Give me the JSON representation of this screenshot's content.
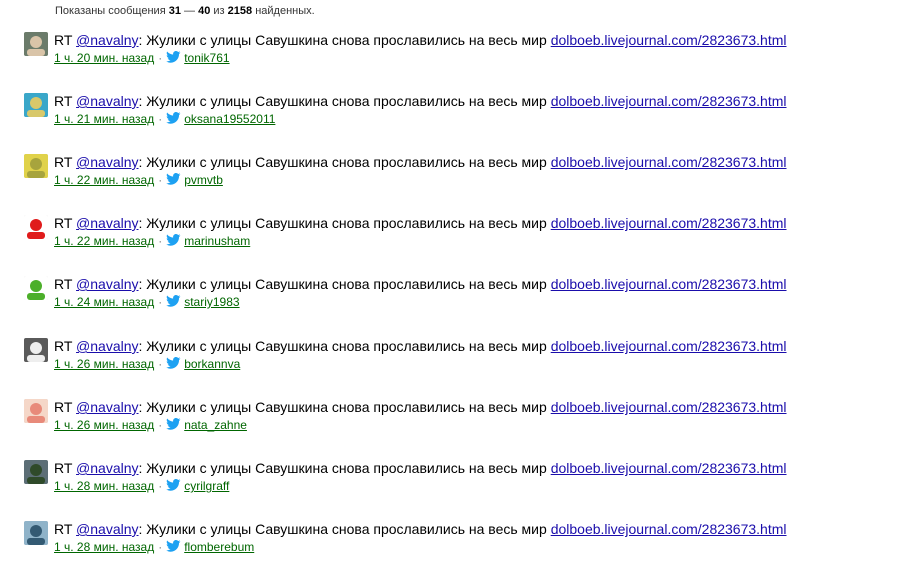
{
  "summary": {
    "prefix": "Показаны сообщения ",
    "from": "31",
    "dash": " — ",
    "to": "40",
    "of": " из ",
    "total": "2158",
    "suffix": " найденных."
  },
  "colors": {
    "link": "#1a0dab",
    "meta_link": "#006600",
    "twitter_blue": "#1da1f2"
  },
  "tweets": [
    {
      "rt": "RT",
      "mention": "@navalny",
      "text": ": Жулики с улицы Савушкина снова прославились на весь мир ",
      "url": "dolboeb.livejournal.com/2823673.html",
      "time": "1 ч. 20 мин. назад",
      "sep": "·",
      "user": "tonik761",
      "avatar_icon": "user-avatar-man-icon",
      "avatar_colors": [
        "#6b7b6a",
        "#d9c4a8"
      ]
    },
    {
      "rt": "RT",
      "mention": "@navalny",
      "text": ": Жулики с улицы Савушкина снова прославились на весь мир ",
      "url": "dolboeb.livejournal.com/2823673.html",
      "time": "1 ч. 21 мин. назад",
      "sep": "·",
      "user": "oksana19552011",
      "avatar_icon": "user-avatar-beach-icon",
      "avatar_colors": [
        "#3aa7c9",
        "#d8c86a"
      ]
    },
    {
      "rt": "RT",
      "mention": "@navalny",
      "text": ": Жулики с улицы Савушкина снова прославились на весь мир ",
      "url": "dolboeb.livejournal.com/2823673.html",
      "time": "1 ч. 22 мин. назад",
      "sep": "·",
      "user": "pvmvtb",
      "avatar_icon": "user-avatar-person-icon",
      "avatar_colors": [
        "#e0d24a",
        "#a7a43d"
      ]
    },
    {
      "rt": "RT",
      "mention": "@navalny",
      "text": ": Жулики с улицы Савушкина снова прославились на весь мир ",
      "url": "dolboeb.livejournal.com/2823673.html",
      "time": "1 ч. 22 мин. назад",
      "sep": "·",
      "user": "marinusham",
      "avatar_icon": "user-avatar-heart-icon",
      "avatar_colors": [
        "#ffffff",
        "#e01b1b"
      ]
    },
    {
      "rt": "RT",
      "mention": "@navalny",
      "text": ": Жулики с улицы Савушкина снова прославились на весь мир ",
      "url": "dolboeb.livejournal.com/2823673.html",
      "time": "1 ч. 24 мин. назад",
      "sep": "·",
      "user": "stariy1983",
      "avatar_icon": "user-avatar-frog-icon",
      "avatar_colors": [
        "#ffffff",
        "#4caf2a"
      ]
    },
    {
      "rt": "RT",
      "mention": "@navalny",
      "text": ": Жулики с улицы Савушкина снова прославились на весь мир ",
      "url": "dolboeb.livejournal.com/2823673.html",
      "time": "1 ч. 26 мин. назад",
      "sep": "·",
      "user": "borkannva",
      "avatar_icon": "user-avatar-dog-icon",
      "avatar_colors": [
        "#5a5a5a",
        "#eeeeee"
      ]
    },
    {
      "rt": "RT",
      "mention": "@navalny",
      "text": ": Жулики с улицы Савушкина снова прославились на весь мир ",
      "url": "dolboeb.livejournal.com/2823673.html",
      "time": "1 ч. 26 мин. назад",
      "sep": "·",
      "user": "nata_zahne",
      "avatar_icon": "user-avatar-girl-icon",
      "avatar_colors": [
        "#f5d7c8",
        "#e88a7a"
      ]
    },
    {
      "rt": "RT",
      "mention": "@navalny",
      "text": ": Жулики с улицы Савушкина снова прославились на весь мир ",
      "url": "dolboeb.livejournal.com/2823673.html",
      "time": "1 ч. 28 мин. назад",
      "sep": "·",
      "user": "cyrilgraff",
      "avatar_icon": "user-avatar-landscape-icon",
      "avatar_colors": [
        "#5c6e76",
        "#2f4a2a"
      ]
    },
    {
      "rt": "RT",
      "mention": "@navalny",
      "text": ": Жулики с улицы Савушкина снова прославились на весь мир ",
      "url": "dolboeb.livejournal.com/2823673.html",
      "time": "1 ч. 28 мин. назад",
      "sep": "·",
      "user": "flomberebum",
      "avatar_icon": "user-avatar-car-icon",
      "avatar_colors": [
        "#8fb3c9",
        "#335a73"
      ]
    }
  ]
}
